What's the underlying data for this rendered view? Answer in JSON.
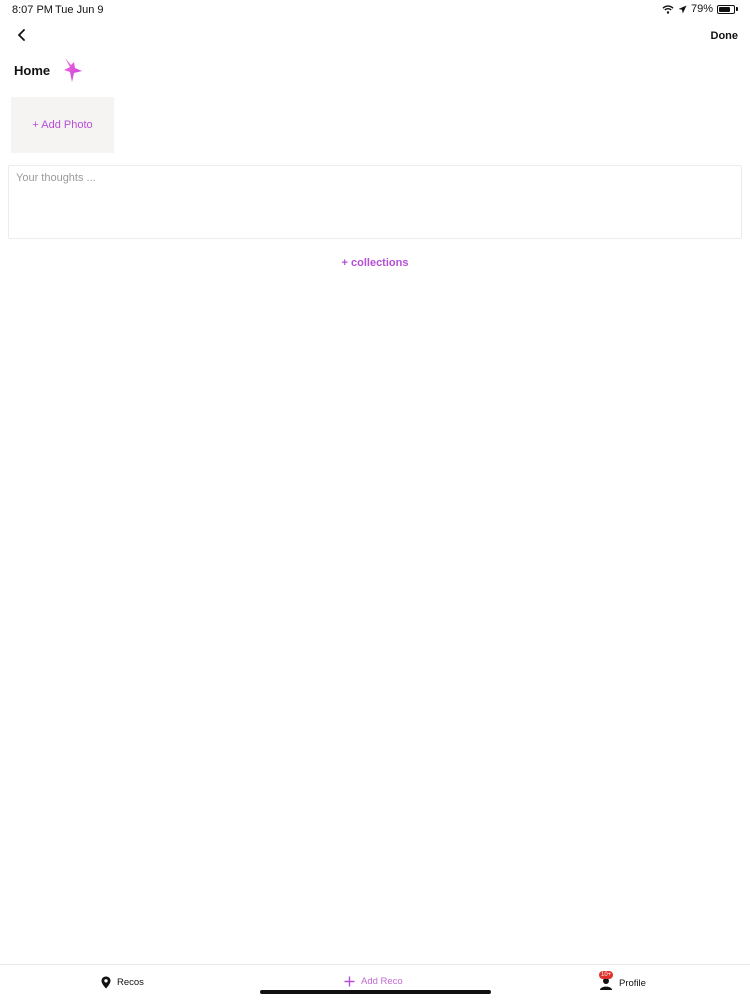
{
  "status_bar": {
    "time": "8:07 PM",
    "date": "Tue Jun 9",
    "battery": "79%",
    "battery_level": 0.79,
    "icons": [
      "wifi-icon",
      "location-arrow-icon",
      "battery-icon"
    ]
  },
  "nav": {
    "back_icon": "chevron-left-icon",
    "done_label": "Done"
  },
  "header": {
    "title": "Home",
    "logo_icon": "bird-icon",
    "accent_color": "#b64fd8"
  },
  "photo": {
    "add_label": "+ Add Photo"
  },
  "thoughts": {
    "placeholder": "Your thoughts ...",
    "value": ""
  },
  "collections": {
    "label": "+ collections"
  },
  "tab_bar": {
    "items": [
      {
        "label": "Recos",
        "icon": "map-pin-icon"
      },
      {
        "label": "Add Reco",
        "icon": "plus-icon"
      },
      {
        "label": "Profile",
        "icon": "person-icon",
        "badge": "10+"
      }
    ]
  }
}
